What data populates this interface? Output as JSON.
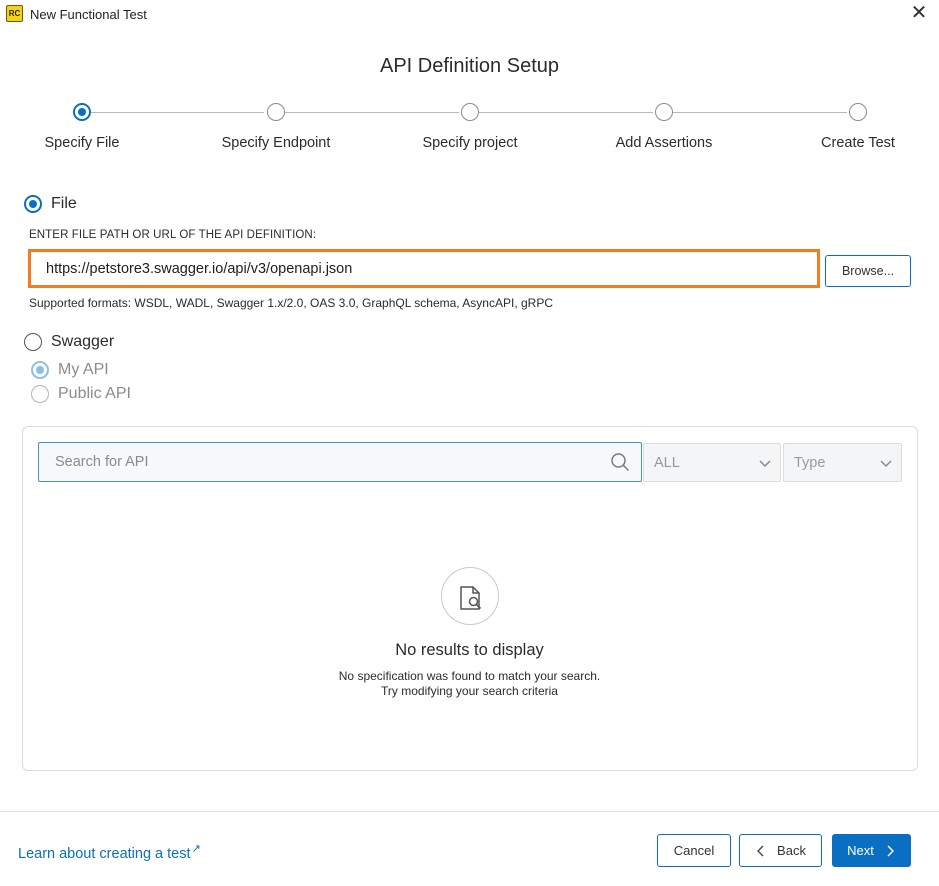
{
  "window": {
    "title": "New Functional Test",
    "app_icon_text": "RC",
    "close_glyph": "✕"
  },
  "page_title": "API Definition Setup",
  "stepper": {
    "steps": [
      {
        "label": "Specify File",
        "state": "active"
      },
      {
        "label": "Specify Endpoint",
        "state": "pending"
      },
      {
        "label": "Specify project",
        "state": "pending"
      },
      {
        "label": "Add Assertions",
        "state": "pending"
      },
      {
        "label": "Create Test",
        "state": "pending"
      }
    ]
  },
  "source": {
    "file_option": {
      "label": "File",
      "selected": true
    },
    "file_caption": "ENTER FILE PATH OR URL OF THE API DEFINITION:",
    "file_value": "https://petstore3.swagger.io/api/v3/openapi.json",
    "browse_label": "Browse...",
    "supported_formats": "Supported formats: WSDL, WADL, Swagger 1.x/2.0, OAS 3.0, GraphQL schema, AsyncAPI, gRPC",
    "swagger_option": {
      "label": "Swagger",
      "selected": false
    },
    "my_api_option": {
      "label": "My API",
      "selected": true
    },
    "public_api_option": {
      "label": "Public API",
      "selected": false
    }
  },
  "search": {
    "placeholder": "Search for API",
    "scope_select": "ALL",
    "type_select": "Type"
  },
  "empty_state": {
    "title": "No results to display",
    "line1": "No specification was found to match your search.",
    "line2": "Try modifying your search criteria"
  },
  "footer": {
    "learn_link": "Learn about creating a test",
    "learn_link_icon": "↗",
    "cancel_label": "Cancel",
    "back_label": "Back",
    "next_label": "Next"
  },
  "colors": {
    "accent": "#0a6fc2",
    "highlight_border": "#f47c20"
  }
}
